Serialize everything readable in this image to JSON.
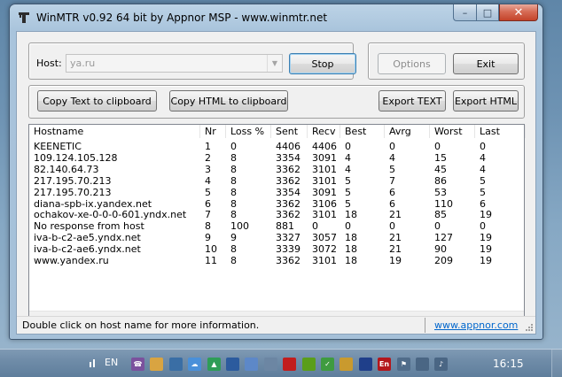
{
  "window": {
    "title": "WinMTR v0.92 64 bit by Appnor MSP - www.winmtr.net",
    "minimize_glyph": "–",
    "maximize_glyph": "□",
    "close_glyph": "✕"
  },
  "host": {
    "label": "Host:",
    "value": "ya.ru",
    "stop_label": "Stop",
    "options_label": "Options",
    "exit_label": "Exit"
  },
  "toolbar": {
    "copy_text_label": "Copy Text to clipboard",
    "copy_html_label": "Copy HTML to clipboard",
    "export_text_label": "Export TEXT",
    "export_html_label": "Export HTML"
  },
  "table": {
    "columns": [
      "Hostname",
      "Nr",
      "Loss %",
      "Sent",
      "Recv",
      "Best",
      "Avrg",
      "Worst",
      "Last"
    ],
    "rows": [
      [
        "KEENETIC",
        "1",
        "0",
        "4406",
        "4406",
        "0",
        "0",
        "0",
        "0"
      ],
      [
        "109.124.105.128",
        "2",
        "8",
        "3354",
        "3091",
        "4",
        "4",
        "15",
        "4"
      ],
      [
        "82.140.64.73",
        "3",
        "8",
        "3362",
        "3101",
        "4",
        "5",
        "45",
        "4"
      ],
      [
        "217.195.70.213",
        "4",
        "8",
        "3362",
        "3101",
        "5",
        "7",
        "86",
        "5"
      ],
      [
        "217.195.70.213",
        "5",
        "8",
        "3354",
        "3091",
        "5",
        "6",
        "53",
        "5"
      ],
      [
        "diana-spb-ix.yandex.net",
        "6",
        "8",
        "3362",
        "3106",
        "5",
        "6",
        "110",
        "6"
      ],
      [
        "ochakov-xe-0-0-0-601.yndx.net",
        "7",
        "8",
        "3362",
        "3101",
        "18",
        "21",
        "85",
        "19"
      ],
      [
        "No response from host",
        "8",
        "100",
        "881",
        "0",
        "0",
        "0",
        "0",
        "0"
      ],
      [
        "iva-b-c2-ae5.yndx.net",
        "9",
        "9",
        "3327",
        "3057",
        "18",
        "21",
        "127",
        "19"
      ],
      [
        "iva-b-c2-ae6.yndx.net",
        "10",
        "8",
        "3339",
        "3072",
        "18",
        "21",
        "90",
        "19"
      ],
      [
        "www.yandex.ru",
        "11",
        "8",
        "3362",
        "3101",
        "18",
        "19",
        "209",
        "19"
      ]
    ]
  },
  "status": {
    "hint": "Double click on host name for more information.",
    "link": "www.appnor.com"
  },
  "taskbar": {
    "language": "EN",
    "clock": "16:15",
    "tray_icons": [
      {
        "name": "viber-icon",
        "color": "#7b519d",
        "glyph": "☎"
      },
      {
        "name": "folder-lock-icon",
        "color": "#d9a441",
        "glyph": ""
      },
      {
        "name": "network-share-icon",
        "color": "#3a6ea5",
        "glyph": ""
      },
      {
        "name": "cloud-icon",
        "color": "#4a90d9",
        "glyph": "☁"
      },
      {
        "name": "google-drive-icon",
        "color": "#2e9d57",
        "glyph": "▲"
      },
      {
        "name": "kerio-icon",
        "color": "#2c5b9e",
        "glyph": ""
      },
      {
        "name": "dropbox-icon",
        "color": "#5d88c8",
        "glyph": ""
      },
      {
        "name": "security-shield-icon",
        "color": "#6c86a3",
        "glyph": ""
      },
      {
        "name": "pdf-icon",
        "color": "#c21d1d",
        "glyph": ""
      },
      {
        "name": "nvidia-icon",
        "color": "#5a9e1a",
        "glyph": ""
      },
      {
        "name": "checkmark-shield-icon",
        "color": "#3f9b3f",
        "glyph": "✓"
      },
      {
        "name": "tool-icon",
        "color": "#c99a2e",
        "glyph": ""
      },
      {
        "name": "ms-icon",
        "color": "#1f3f8a",
        "glyph": ""
      },
      {
        "name": "language-bar-icon",
        "color": "#b4161b",
        "glyph": "En"
      },
      {
        "name": "action-center-flag-icon",
        "color": "#506c8a",
        "glyph": "⚑"
      },
      {
        "name": "network-icon",
        "color": "#4a6684",
        "glyph": ""
      },
      {
        "name": "volume-icon",
        "color": "#4a6684",
        "glyph": "♪"
      }
    ]
  }
}
